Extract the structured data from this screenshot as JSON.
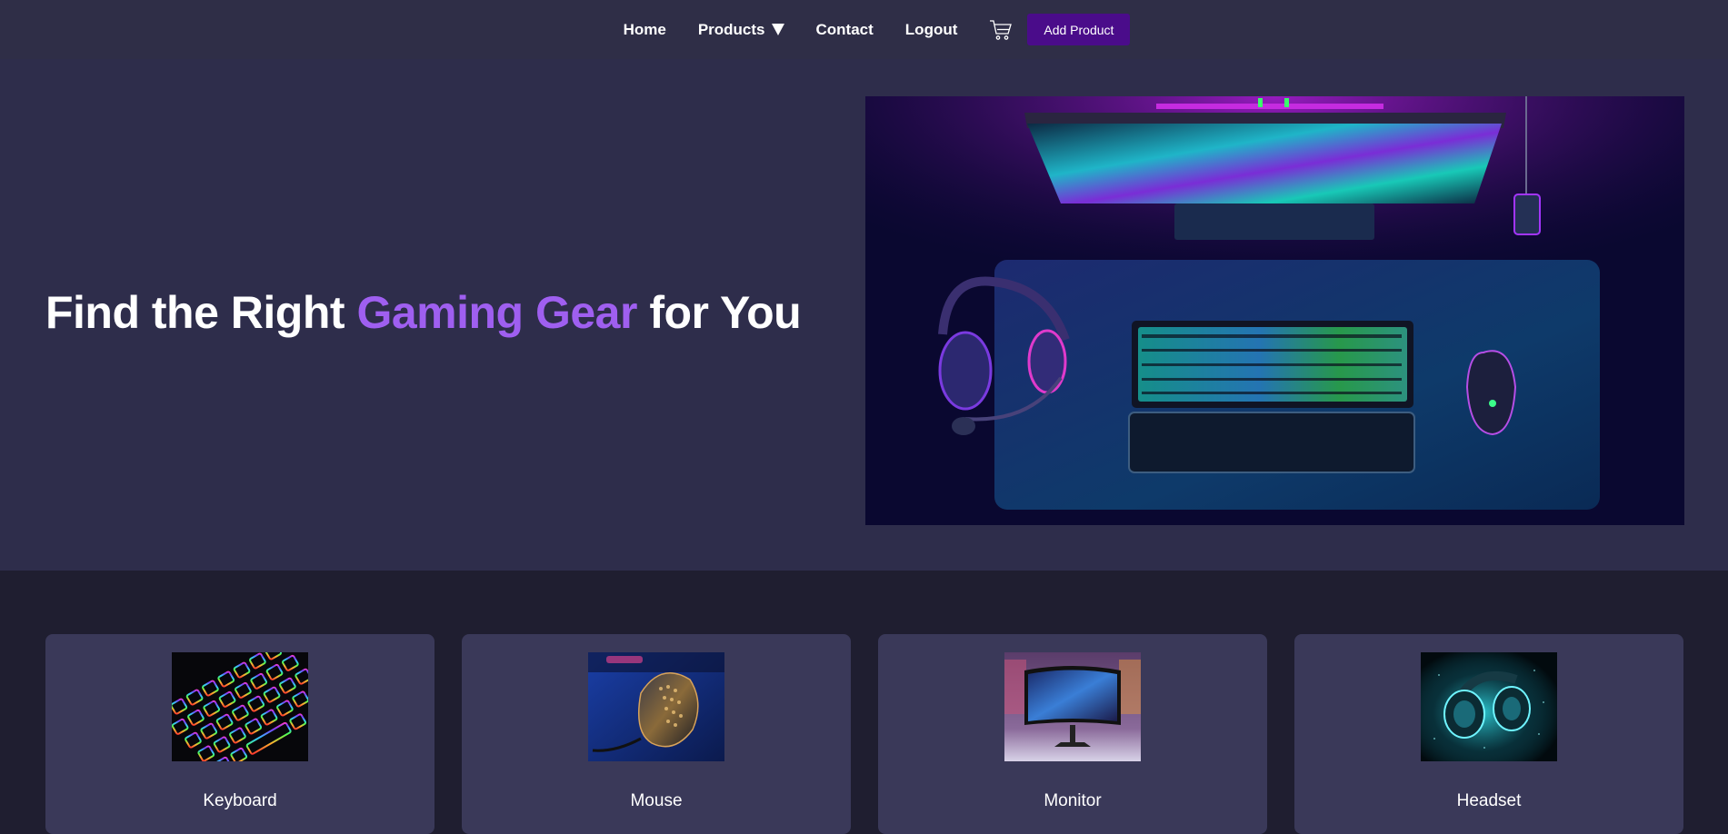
{
  "nav": {
    "home": "Home",
    "products": "Products",
    "contact": "Contact",
    "logout": "Logout",
    "cart_icon": "cart-icon",
    "add_product": "Add Product"
  },
  "hero": {
    "title_before": "Find the Right ",
    "title_accent": "Gaming Gear",
    "title_after": " for You",
    "accent_color": "#9f5ff0"
  },
  "categories": [
    {
      "label": "Keyboard"
    },
    {
      "label": "Mouse"
    },
    {
      "label": "Monitor"
    },
    {
      "label": "Headset"
    }
  ],
  "colors": {
    "nav_bg": "#2f2e47",
    "hero_bg": "#2e2d4b",
    "page_bg": "#1f1e30",
    "card_bg": "#3a3959",
    "button_bg": "#4a0c8a"
  }
}
